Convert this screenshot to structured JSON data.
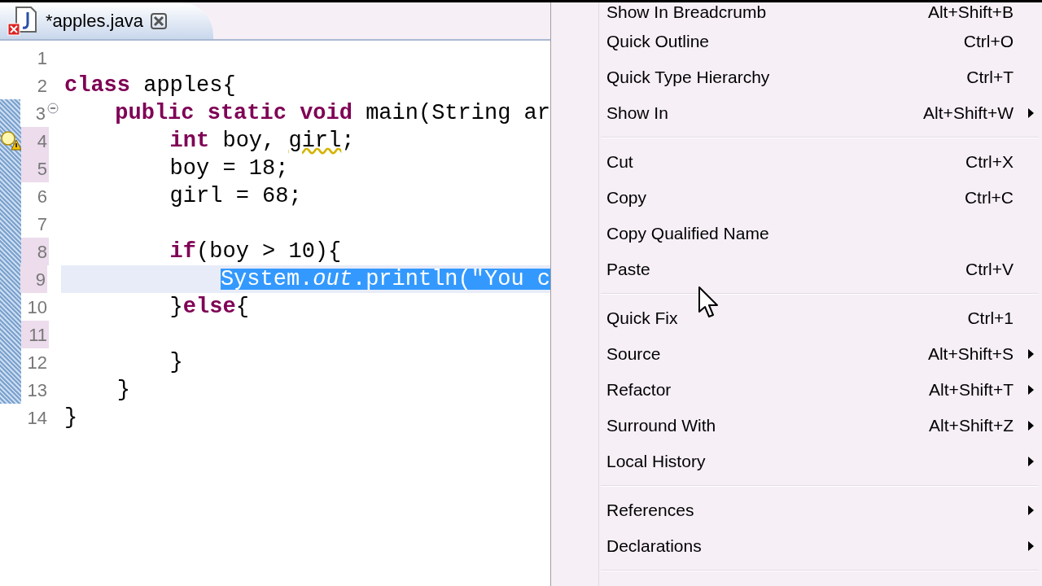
{
  "editor_tab": {
    "title": "*apples.java",
    "has_error": true
  },
  "lines": [
    {
      "number": "1",
      "changed": false,
      "current": false,
      "in_range": false,
      "fold_marker": false,
      "warning": false
    },
    {
      "number": "2",
      "changed": false,
      "current": false,
      "in_range": false,
      "fold_marker": false,
      "warning": false,
      "tokens": [
        {
          "text": "class",
          "kind": "keyword"
        },
        {
          "text": " apples{",
          "kind": "plain"
        }
      ]
    },
    {
      "number": "3",
      "changed": false,
      "current": false,
      "in_range": true,
      "fold_marker": true,
      "warning": false,
      "tokens": [
        {
          "text": "    public",
          "kind": "keyword"
        },
        {
          "text": " static",
          "kind": "keyword"
        },
        {
          "text": " void",
          "kind": "keyword"
        },
        {
          "text": " main(String ar",
          "kind": "plain"
        }
      ]
    },
    {
      "number": "4",
      "changed": true,
      "current": false,
      "in_range": true,
      "fold_marker": false,
      "warning": true,
      "tokens": [
        {
          "text": "        int",
          "kind": "keyword"
        },
        {
          "text": " boy, ",
          "kind": "plain"
        },
        {
          "text": "girl",
          "kind": "warning"
        },
        {
          "text": ";",
          "kind": "plain"
        }
      ]
    },
    {
      "number": "5",
      "changed": true,
      "current": false,
      "in_range": true,
      "fold_marker": false,
      "warning": false,
      "tokens": [
        {
          "text": "        boy = 18;",
          "kind": "plain"
        }
      ]
    },
    {
      "number": "6",
      "changed": false,
      "current": false,
      "in_range": true,
      "fold_marker": false,
      "warning": false,
      "tokens": [
        {
          "text": "        girl = 68;",
          "kind": "plain"
        }
      ]
    },
    {
      "number": "7",
      "changed": false,
      "current": false,
      "in_range": true,
      "fold_marker": false,
      "warning": false
    },
    {
      "number": "8",
      "changed": true,
      "current": false,
      "in_range": true,
      "fold_marker": false,
      "warning": false,
      "tokens": [
        {
          "text": "        if",
          "kind": "keyword"
        },
        {
          "text": "(boy > 10){",
          "kind": "plain"
        }
      ]
    },
    {
      "number": "9",
      "changed": true,
      "current": true,
      "in_range": true,
      "fold_marker": false,
      "warning": false,
      "tokens": [
        {
          "text": "            System.",
          "kind": "selected"
        },
        {
          "text": "out",
          "kind": "selected_field"
        },
        {
          "text": ".println(\"You c",
          "kind": "selected"
        }
      ]
    },
    {
      "number": "10",
      "changed": false,
      "current": false,
      "in_range": true,
      "fold_marker": false,
      "warning": false,
      "tokens": [
        {
          "text": "        }",
          "kind": "plain"
        },
        {
          "text": "else",
          "kind": "keyword"
        },
        {
          "text": "{",
          "kind": "plain"
        }
      ]
    },
    {
      "number": "11",
      "changed": true,
      "current": false,
      "in_range": true,
      "fold_marker": false,
      "warning": false
    },
    {
      "number": "12",
      "changed": false,
      "current": false,
      "in_range": true,
      "fold_marker": false,
      "warning": false,
      "tokens": [
        {
          "text": "        }",
          "kind": "plain"
        }
      ]
    },
    {
      "number": "13",
      "changed": false,
      "current": false,
      "in_range": true,
      "fold_marker": false,
      "warning": false,
      "tokens": [
        {
          "text": "    }",
          "kind": "plain"
        }
      ]
    },
    {
      "number": "14",
      "changed": false,
      "current": false,
      "in_range": false,
      "fold_marker": false,
      "warning": false,
      "tokens": [
        {
          "text": "}",
          "kind": "plain"
        }
      ]
    }
  ],
  "context_menu": {
    "groups": [
      [
        {
          "label": "Show In Breadcrumb",
          "shortcut": "Alt+Shift+B",
          "submenu": false
        },
        {
          "label": "Quick Outline",
          "shortcut": "Ctrl+O",
          "submenu": false
        },
        {
          "label": "Quick Type Hierarchy",
          "shortcut": "Ctrl+T",
          "submenu": false
        },
        {
          "label": "Show In",
          "shortcut": "Alt+Shift+W",
          "submenu": true
        }
      ],
      [
        {
          "label": "Cut",
          "shortcut": "Ctrl+X",
          "submenu": false
        },
        {
          "label": "Copy",
          "shortcut": "Ctrl+C",
          "submenu": false
        },
        {
          "label": "Copy Qualified Name",
          "submenu": false
        },
        {
          "label": "Paste",
          "shortcut": "Ctrl+V",
          "submenu": false
        }
      ],
      [
        {
          "label": "Quick Fix",
          "shortcut": "Ctrl+1",
          "submenu": false
        },
        {
          "label": "Source",
          "shortcut": "Alt+Shift+S",
          "submenu": true
        },
        {
          "label": "Refactor",
          "shortcut": "Alt+Shift+T",
          "submenu": true
        },
        {
          "label": "Surround With",
          "shortcut": "Alt+Shift+Z",
          "submenu": true
        },
        {
          "label": "Local History",
          "submenu": true
        }
      ],
      [
        {
          "label": "References",
          "submenu": true
        },
        {
          "label": "Declarations",
          "submenu": true
        }
      ]
    ]
  }
}
